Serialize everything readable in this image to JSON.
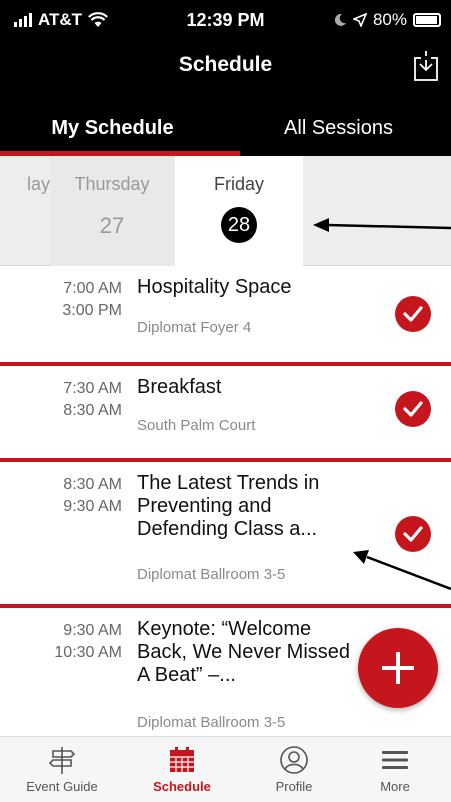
{
  "status": {
    "carrier": "AT&T",
    "time": "12:39 PM",
    "battery": "80%"
  },
  "nav": {
    "title": "Schedule"
  },
  "tabs": [
    {
      "label": "My Schedule",
      "active": true
    },
    {
      "label": "All Sessions",
      "active": false
    }
  ],
  "dates": [
    {
      "name": "lay",
      "number": ""
    },
    {
      "name": "Thursday",
      "number": "27"
    },
    {
      "name": "Friday",
      "number": "28",
      "selected": true
    }
  ],
  "sessions": [
    {
      "start": "7:00 AM",
      "end": "3:00 PM",
      "title": "Hospitality Space",
      "location": "Diplomat Foyer 4",
      "added": true
    },
    {
      "start": "7:30 AM",
      "end": "8:30 AM",
      "title": "Breakfast",
      "location": "South Palm Court",
      "added": true
    },
    {
      "start": "8:30 AM",
      "end": "9:30 AM",
      "title": "The Latest Trends in Preventing and Defending Class a...",
      "location": "Diplomat Ballroom 3-5",
      "added": true
    },
    {
      "start": "9:30 AM",
      "end": "10:30 AM",
      "title": "Keynote: “Welcome Back, We Never Missed A Beat” –...",
      "location": "Diplomat Ballroom 3-5",
      "added": false
    }
  ],
  "tab_bar": [
    {
      "label": "Event Guide",
      "icon": "signpost-icon",
      "active": false
    },
    {
      "label": "Schedule",
      "icon": "calendar-icon",
      "active": true
    },
    {
      "label": "Profile",
      "icon": "profile-icon",
      "active": false
    },
    {
      "label": "More",
      "icon": "menu-icon",
      "active": false
    }
  ],
  "colors": {
    "accent": "#c4161c",
    "header": "#000000"
  }
}
